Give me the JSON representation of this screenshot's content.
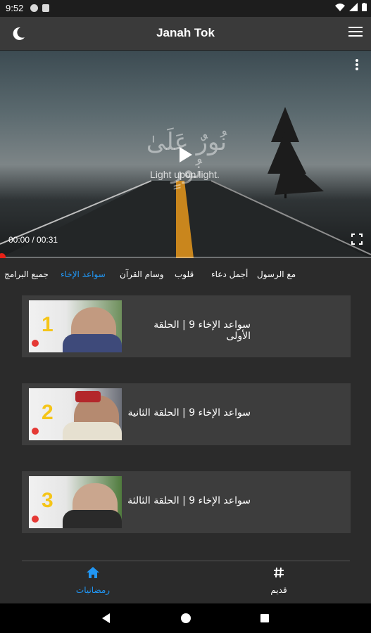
{
  "status_bar": {
    "time": "9:52"
  },
  "app_bar": {
    "title": "Janah Tok",
    "moon_icon": "moon-icon",
    "menu_icon": "hamburger-menu-icon"
  },
  "video": {
    "arabic_overlay": "نُورٌ عَلَىٰ نُورٍ",
    "english_overlay": "Light upon light.",
    "time": "00:00 / 00:31",
    "progress": 0.0
  },
  "tabs": [
    {
      "label": "مع الرسول",
      "active": false
    },
    {
      "label": "أجمل دعاء",
      "active": false
    },
    {
      "label": "قلوب",
      "active": false
    },
    {
      "label": "وسام القرآن",
      "active": false
    },
    {
      "label": "سواعد الإخاء",
      "active": true
    },
    {
      "label": "جميع البرامج",
      "active": false
    }
  ],
  "episodes": [
    {
      "number": "1",
      "title": "سواعد الإخاء 9 | الحلقة الأولى"
    },
    {
      "number": "2",
      "title": "سواعد الإخاء 9 | الحلقة الثانية"
    },
    {
      "number": "3",
      "title": "سواعد الإخاء 9 | الحلقة الثالثة"
    }
  ],
  "bottom_nav": [
    {
      "label": "رمضانيات",
      "icon": "home-icon",
      "active": true
    },
    {
      "label": "قديم",
      "icon": "hash-icon",
      "active": false
    }
  ],
  "colors": {
    "accent": "#2196f3",
    "progress": "#e62117",
    "number": "#f5c518"
  }
}
